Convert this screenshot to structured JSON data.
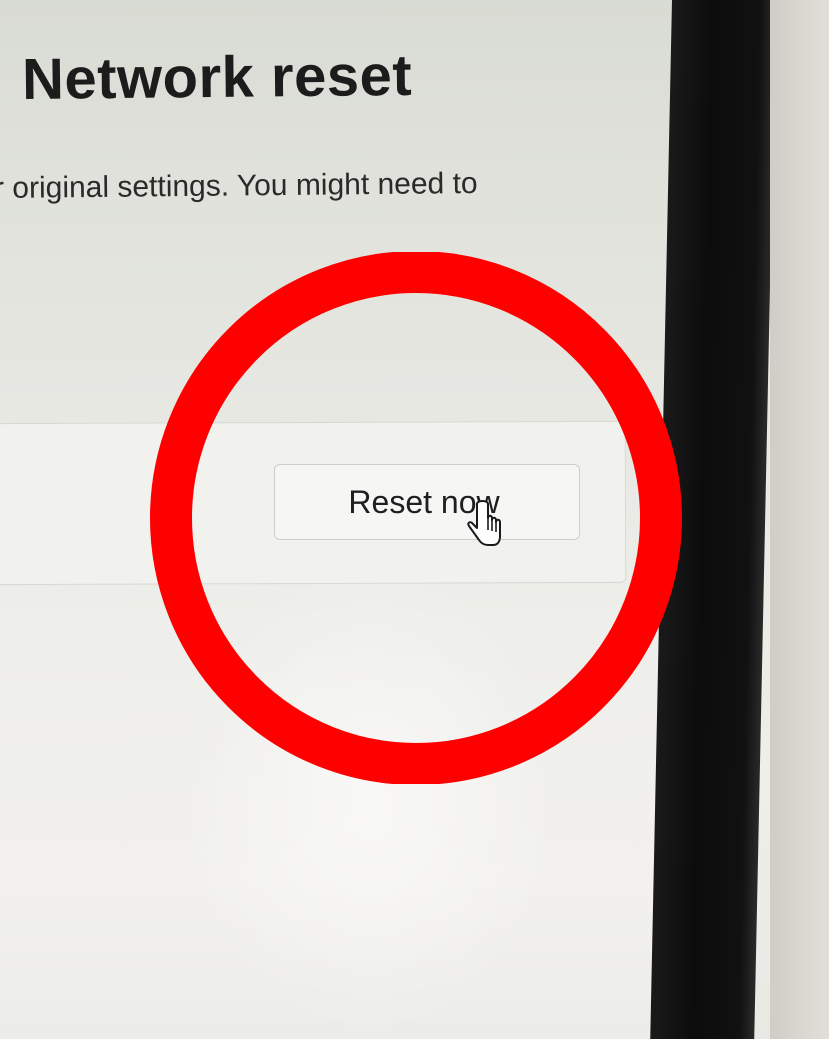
{
  "page": {
    "title": "Network reset",
    "description": "r original settings. You might need to"
  },
  "card": {
    "button_label": "Reset now"
  },
  "annotation": {
    "highlight_color": "#ff0000",
    "shape": "circle"
  },
  "icons": {
    "cursor": "mouse-pointer-icon"
  }
}
